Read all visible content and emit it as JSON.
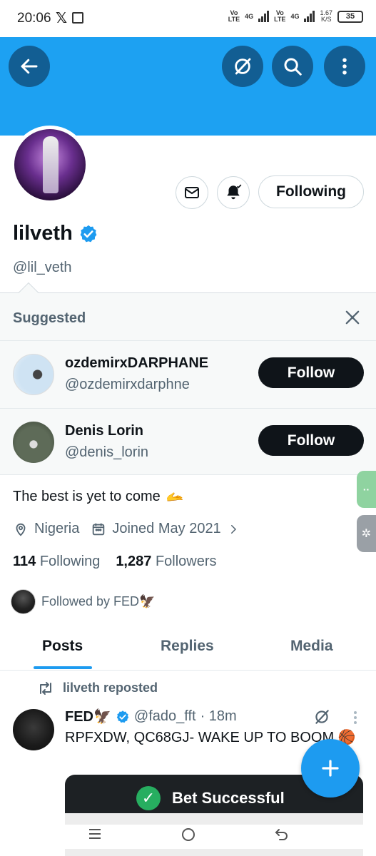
{
  "status_bar": {
    "time": "20:06",
    "x_icon": "x-logo-icon",
    "net1_top": "Vo",
    "net1_bottom": "LTE",
    "net1_gen": "4G",
    "net2_top": "Vo",
    "net2_bottom": "LTE",
    "net2_gen": "4G",
    "speed_value": "1.67",
    "speed_unit": "K/S",
    "battery": "35"
  },
  "profile": {
    "display_name": "lilveth",
    "handle": "@lil_veth",
    "following_label": "Following",
    "bio": "The best is yet to come",
    "bio_emoji": "🫴",
    "location": "Nigeria",
    "joined": "Joined May 2021",
    "following_count": "114",
    "following_label_text": "Following",
    "followers_count": "1,287",
    "followers_label_text": "Followers",
    "followed_by": "Followed by FED🦅",
    "accent_color": "#1d9bf0",
    "banner_color": "#1da1f2"
  },
  "suggested": {
    "title": "Suggested",
    "items": [
      {
        "name": "ozdemirxDARPHANE",
        "handle": "@ozdemirxdarphne",
        "button": "Follow"
      },
      {
        "name": "Denis Lorin",
        "handle": "@denis_lorin",
        "button": "Follow"
      }
    ]
  },
  "tabs": [
    {
      "label": "Posts",
      "active": true
    },
    {
      "label": "Replies",
      "active": false
    },
    {
      "label": "Media",
      "active": false
    }
  ],
  "post": {
    "repost_label": "lilveth reposted",
    "author_name": "FED🦅",
    "author_handle": "@fado_fft",
    "time": "· 18m",
    "text": "RPFXDW, QC68GJ- WAKE UP TO BOOM 🏀",
    "card_text": "Bet Successful"
  }
}
